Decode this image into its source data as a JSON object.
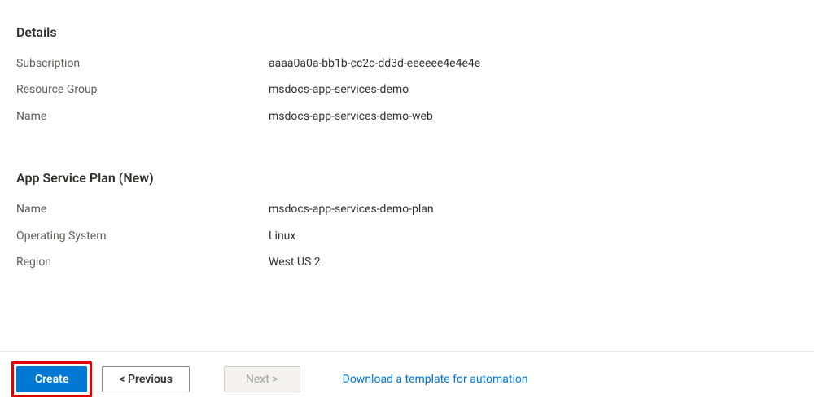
{
  "details": {
    "title": "Details",
    "rows": [
      {
        "label": "Subscription",
        "value": "aaaa0a0a-bb1b-cc2c-dd3d-eeeeee4e4e4e"
      },
      {
        "label": "Resource Group",
        "value": "msdocs-app-services-demo"
      },
      {
        "label": "Name",
        "value": "msdocs-app-services-demo-web"
      }
    ]
  },
  "plan": {
    "title": "App Service Plan (New)",
    "rows": [
      {
        "label": "Name",
        "value": "msdocs-app-services-demo-plan"
      },
      {
        "label": "Operating System",
        "value": "Linux"
      },
      {
        "label": "Region",
        "value": "West US 2"
      }
    ]
  },
  "footer": {
    "create": "Create",
    "previous": "< Previous",
    "next": "Next >",
    "download_link": "Download a template for automation"
  }
}
